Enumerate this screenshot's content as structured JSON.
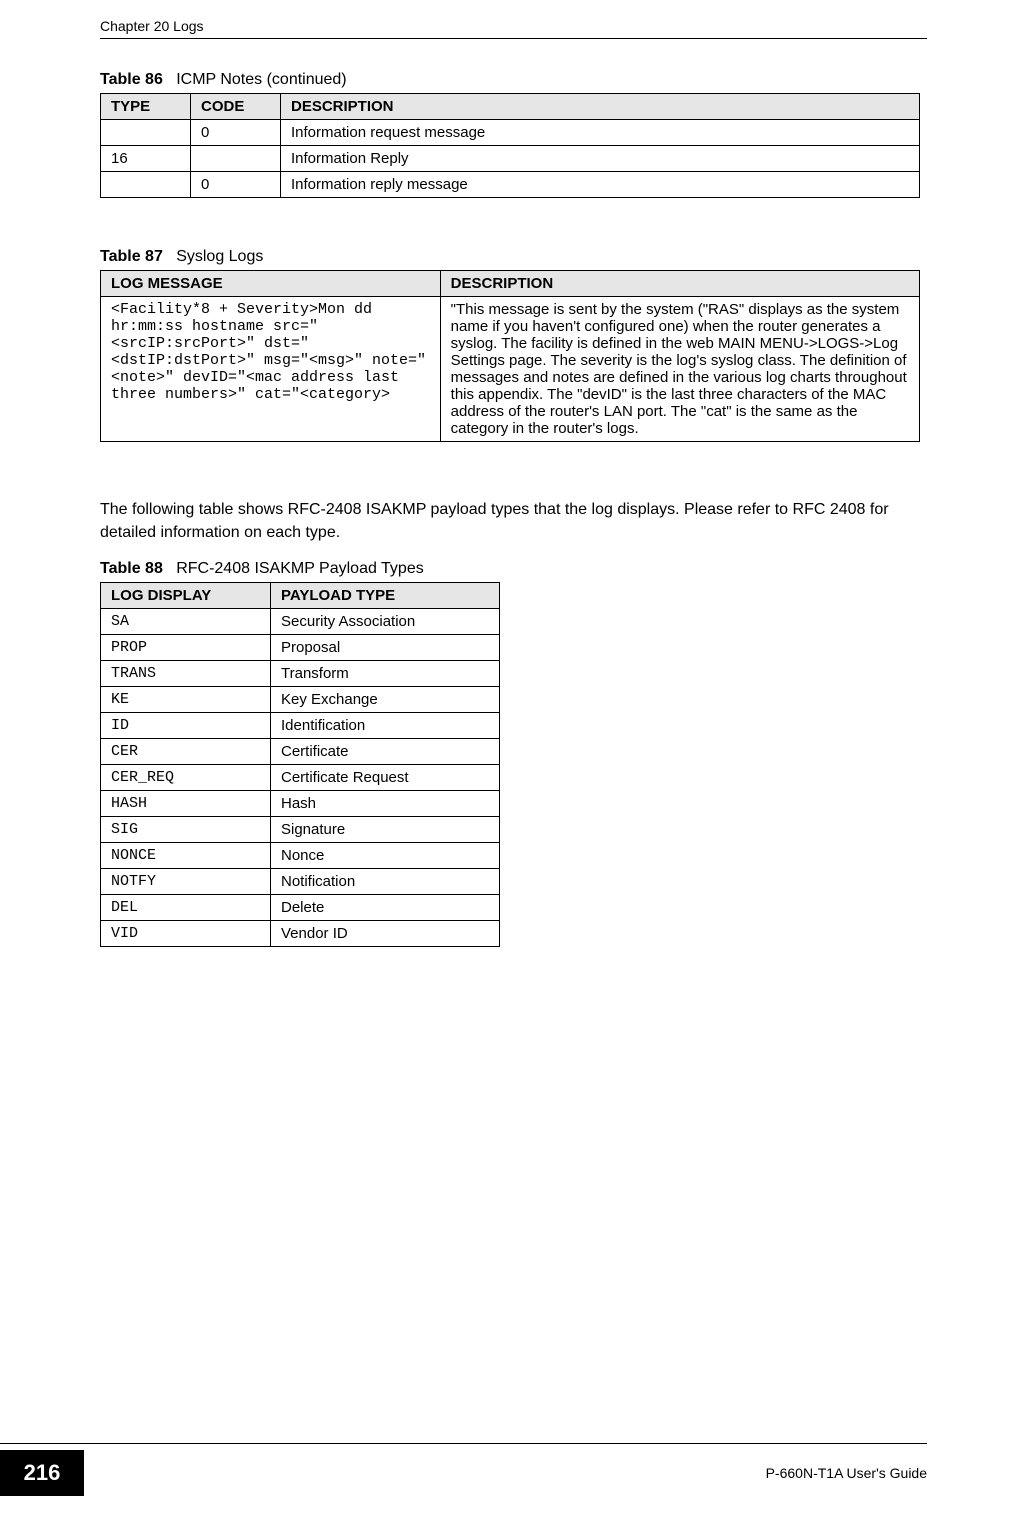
{
  "header": {
    "chapter": "Chapter 20 Logs"
  },
  "table86": {
    "label": "Table 86",
    "title": "ICMP Notes (continued)",
    "headers": {
      "type": "TYPE",
      "code": "CODE",
      "description": "DESCRIPTION"
    },
    "rows": [
      {
        "type": "",
        "code": "0",
        "description": "Information request message"
      },
      {
        "type": "16",
        "code": "",
        "description": "Information Reply"
      },
      {
        "type": "",
        "code": "0",
        "description": "Information reply message"
      }
    ]
  },
  "table87": {
    "label": "Table 87",
    "title": "Syslog Logs",
    "headers": {
      "log_message": "LOG MESSAGE",
      "description": "DESCRIPTION"
    },
    "row": {
      "log_message": "<Facility*8 + Severity>Mon dd hr:mm:ss hostname src=\"<srcIP:srcPort>\" dst=\"<dstIP:dstPort>\" msg=\"<msg>\" note=\"<note>\" devID=\"<mac address last three numbers>\" cat=\"<category>",
      "description": "\"This message is sent by the system (\"RAS\" displays as the system name if you haven't configured one) when the router generates a syslog. The facility is defined in the web MAIN MENU->LOGS->Log Settings page. The severity is the log's syslog class. The definition of messages and notes are defined in the various log charts throughout this appendix. The \"devID\" is the last three characters of the MAC address of the router's LAN port. The \"cat\" is the same as the category in the router's logs."
    }
  },
  "para": "The following table shows RFC-2408 ISAKMP payload types that the log displays. Please refer to RFC 2408 for detailed information on each type.",
  "table88": {
    "label": "Table 88",
    "title": "RFC-2408 ISAKMP Payload Types",
    "headers": {
      "log_display": "LOG DISPLAY",
      "payload_type": "PAYLOAD TYPE"
    },
    "rows": [
      {
        "log_display": "SA",
        "payload_type": "Security Association"
      },
      {
        "log_display": "PROP",
        "payload_type": "Proposal"
      },
      {
        "log_display": "TRANS",
        "payload_type": "Transform"
      },
      {
        "log_display": "KE",
        "payload_type": "Key Exchange"
      },
      {
        "log_display": "ID",
        "payload_type": "Identification"
      },
      {
        "log_display": "CER",
        "payload_type": "Certificate"
      },
      {
        "log_display": "CER_REQ",
        "payload_type": "Certificate Request"
      },
      {
        "log_display": "HASH",
        "payload_type": "Hash"
      },
      {
        "log_display": "SIG",
        "payload_type": "Signature"
      },
      {
        "log_display": "NONCE",
        "payload_type": "Nonce"
      },
      {
        "log_display": "NOTFY",
        "payload_type": "Notification"
      },
      {
        "log_display": "DEL",
        "payload_type": "Delete"
      },
      {
        "log_display": "VID",
        "payload_type": "Vendor ID"
      }
    ]
  },
  "footer": {
    "page_number": "216",
    "book_title": "P-660N-T1A User's Guide"
  }
}
